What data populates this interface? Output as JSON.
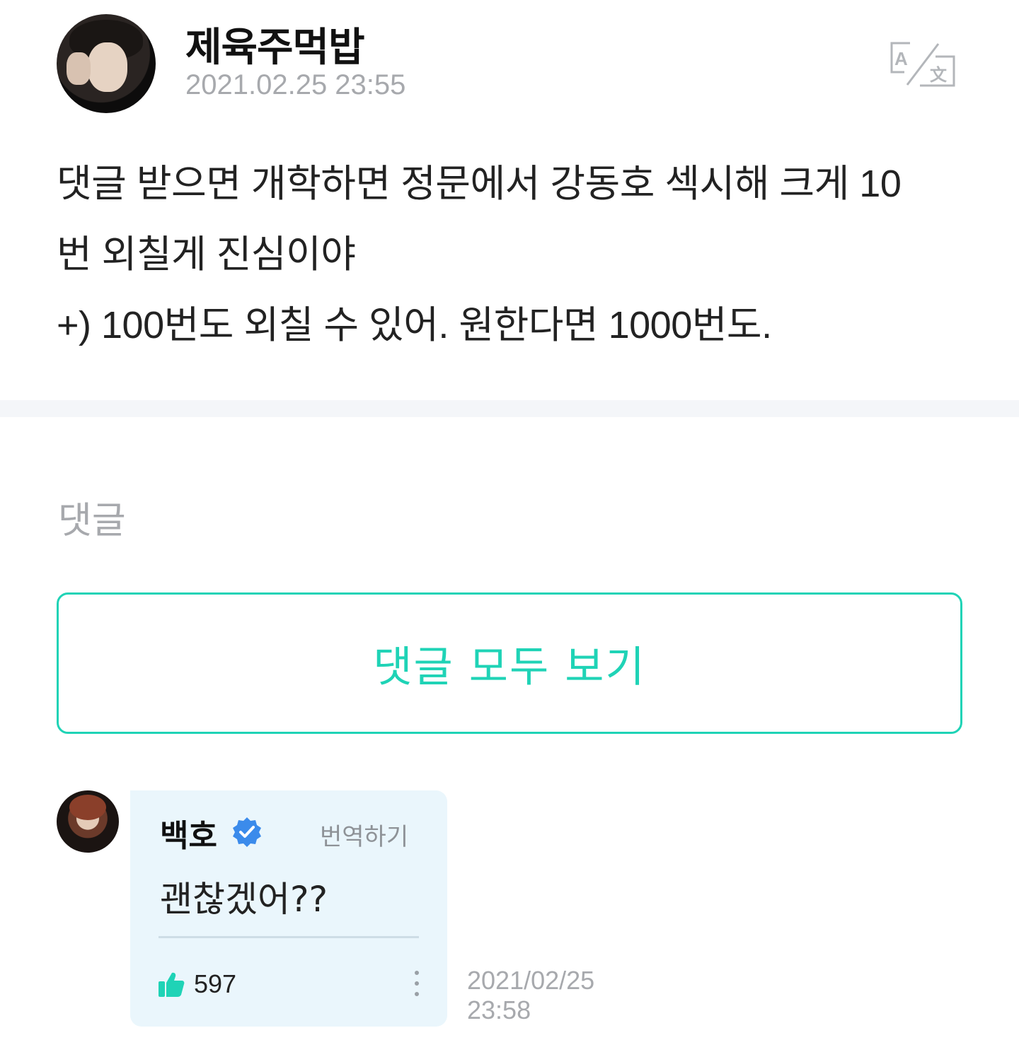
{
  "post": {
    "author": "제육주먹밥",
    "timestamp": "2021.02.25 23:55",
    "translate_icon": "translate-icon",
    "body_lines": [
      "댓글 받으면 개학하면 정문에서 강동호 섹시해 크게 10",
      "번 외칠게 진심이야",
      "+) 100번도 외칠 수 있어. 원한다면 1000번도."
    ]
  },
  "comments_section": {
    "title": "댓글",
    "view_all_label": "댓글 모두 보기"
  },
  "comment": {
    "author": "백호",
    "verified_icon": "verified-badge-icon",
    "translate_label": "번역하기",
    "text": "괜찮겠어??",
    "like_icon": "thumbs-up-icon",
    "like_count": "597",
    "more_icon": "more-vertical-icon",
    "date": "2021/02/25",
    "time": "23:58"
  },
  "colors": {
    "accent": "#1fd3b6",
    "muted_text": "#a7a9ad",
    "bubble_bg": "#eaf6fc",
    "verified_blue": "#3b8beb"
  }
}
